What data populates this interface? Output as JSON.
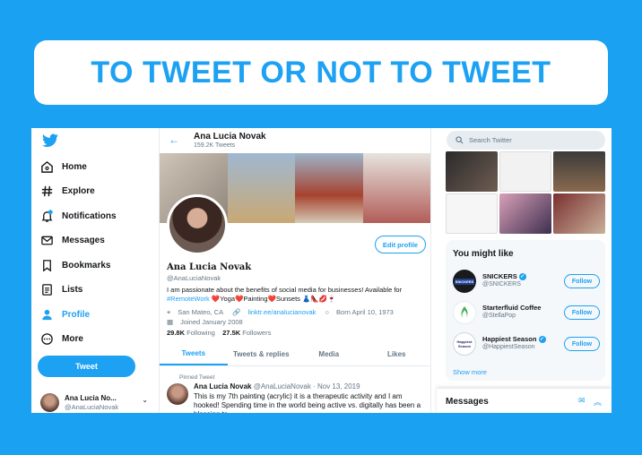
{
  "banner": {
    "title": "TO TWEET OR NOT TO TWEET"
  },
  "nav": {
    "items": [
      {
        "label": "Home",
        "icon": "home-icon"
      },
      {
        "label": "Explore",
        "icon": "hashtag-icon"
      },
      {
        "label": "Notifications",
        "icon": "bell-icon",
        "badge": "1"
      },
      {
        "label": "Messages",
        "icon": "envelope-icon"
      },
      {
        "label": "Bookmarks",
        "icon": "bookmark-icon"
      },
      {
        "label": "Lists",
        "icon": "list-icon"
      },
      {
        "label": "Profile",
        "icon": "person-icon",
        "active": true
      },
      {
        "label": "More",
        "icon": "more-icon"
      }
    ],
    "tweet_button": "Tweet",
    "account": {
      "name": "Ana Lucia No...",
      "handle": "@AnaLuciaNovak"
    }
  },
  "profile": {
    "header_name": "Ana Lucia Novak",
    "header_count": "159.2K Tweets",
    "edit_button": "Edit profile",
    "name": "Ana Lucia Novak",
    "handle": "@AnaLuciaNovak",
    "bio_line1": "I am passionate about the benefits of social media for businesses! Available for",
    "bio_line2_tag": "#RemoteWork",
    "bio_line2_rest": " ❤️Yoga❤️Painting❤️Sunsets 👗👠💋🍷",
    "location": "San Mateo, CA",
    "link": "linktr.ee/analucianovak",
    "born": "Born April 10, 1973",
    "joined": "Joined January 2008",
    "following_count": "29.8K",
    "following_label": "Following",
    "followers_count": "27.5K",
    "followers_label": "Followers",
    "tabs": [
      "Tweets",
      "Tweets & replies",
      "Media",
      "Likes"
    ],
    "pinned_label": "Pinned Tweet",
    "tweet": {
      "name": "Ana Lucia Novak",
      "handle_date": "@AnaLuciaNovak · Nov 13, 2019",
      "text": "This is my 7th painting (acrylic) it is a therapeutic activity and I am hooked! Spending time in the world being active vs. digitally has been a blessing to"
    }
  },
  "right": {
    "search_placeholder": "Search Twitter",
    "you_might_like": "You might like",
    "suggestions": [
      {
        "name": "SNICKERS",
        "handle": "@SNICKERS",
        "logo_text": "SNICKERS",
        "logo_color": "#1a1a1a",
        "verified": true
      },
      {
        "name": "Starterfluid Coffee",
        "handle": "@StellaPop",
        "logo_text": "",
        "logo_color": "#3fae49",
        "verified": false
      },
      {
        "name": "Happiest Season",
        "handle": "@HappiestSeason",
        "logo_text": "Happiest Season",
        "logo_color": "#1f2a5c",
        "verified": true
      }
    ],
    "follow_label": "Follow",
    "show_more": "Show more",
    "messages_title": "Messages"
  },
  "colors": {
    "accent": "#1da1f2",
    "background": "#1ba1f2"
  }
}
